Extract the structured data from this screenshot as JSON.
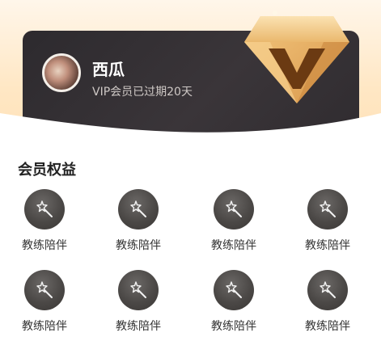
{
  "user": {
    "name": "西瓜",
    "vip_status": "VIP会员已过期20天"
  },
  "benefits_section": {
    "title": "会员权益",
    "items": [
      {
        "label": "教练陪伴",
        "icon": "magic-wand-icon"
      },
      {
        "label": "教练陪伴",
        "icon": "magic-wand-icon"
      },
      {
        "label": "教练陪伴",
        "icon": "magic-wand-icon"
      },
      {
        "label": "教练陪伴",
        "icon": "magic-wand-icon"
      },
      {
        "label": "教练陪伴",
        "icon": "magic-wand-icon"
      },
      {
        "label": "教练陪伴",
        "icon": "magic-wand-icon"
      },
      {
        "label": "教练陪伴",
        "icon": "magic-wand-icon"
      },
      {
        "label": "教练陪伴",
        "icon": "magic-wand-icon"
      }
    ]
  },
  "colors": {
    "card_bg": "#2d2a2e",
    "header_bg": "#ffe0b5",
    "diamond_gold": "#e8b46a",
    "icon_circle": "#4b4846"
  }
}
